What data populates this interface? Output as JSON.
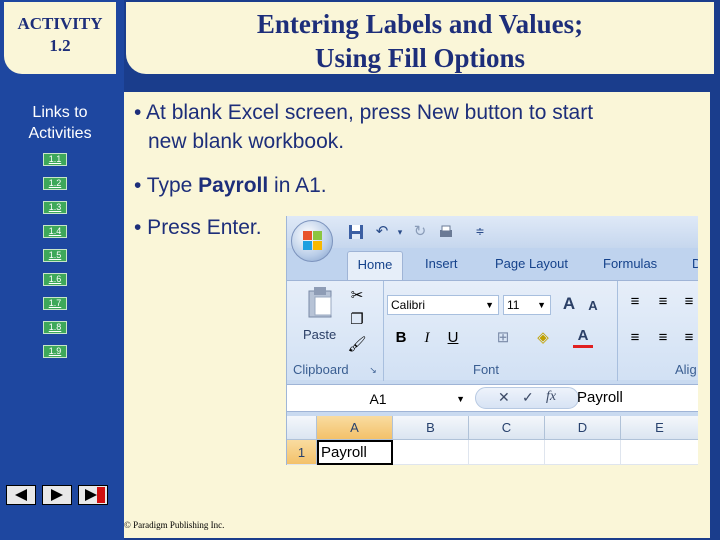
{
  "activity": {
    "line1": "ACTIVITY",
    "line2": "1.2"
  },
  "title": {
    "line1": "Entering Labels and Values;",
    "line2": "Using Fill Options"
  },
  "sidebar": {
    "links_label_1": "Links to",
    "links_label_2": "Activities",
    "links": [
      "1.1",
      "1.2",
      "1.3",
      "1.4",
      "1.5",
      "1.6",
      "1.7",
      "1.8",
      "1.9"
    ]
  },
  "bullets": {
    "b1_line1": "• At blank Excel screen, press New button to start",
    "b1_line2": "new blank workbook.",
    "b2_pre": "• Type ",
    "b2_bold": "Payroll",
    "b2_post": " in A1.",
    "b3": "• Press Enter."
  },
  "excel": {
    "tabs": [
      "Home",
      "Insert",
      "Page Layout",
      "Formulas",
      "D"
    ],
    "font_name": "Calibri",
    "font_size": "11",
    "paste_label": "Paste",
    "groups": {
      "clipboard": "Clipboard",
      "font": "Font",
      "alignment": "Alig"
    },
    "name_box": "A1",
    "fx_label": "fx",
    "formula_value": "Payroll",
    "columns": [
      "A",
      "B",
      "C",
      "D",
      "E"
    ],
    "row_number": "1",
    "cell_a1": "Payroll"
  },
  "copyright": "© Paradigm Publishing Inc."
}
